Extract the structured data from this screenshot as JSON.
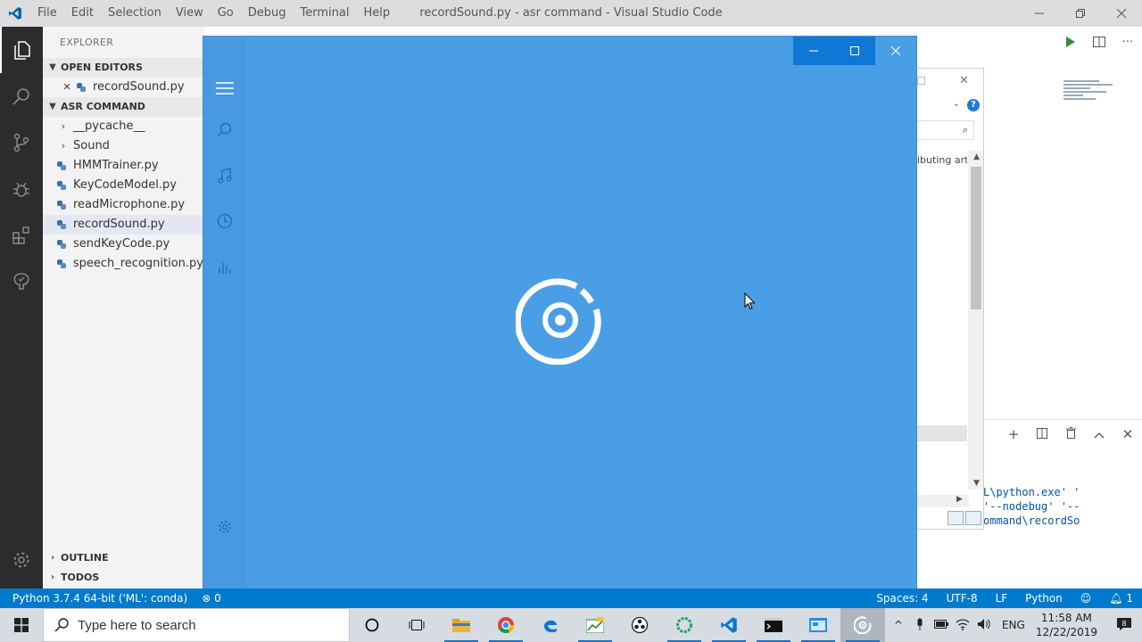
{
  "vscode": {
    "menu": [
      "File",
      "Edit",
      "Selection",
      "View",
      "Go",
      "Debug",
      "Terminal",
      "Help"
    ],
    "title": "recordSound.py - asr command - Visual Studio Code",
    "sidebar": {
      "title": "EXPLORER",
      "open_editors_label": "OPEN EDITORS",
      "open_editor_file": "recordSound.py",
      "project_label": "ASR COMMAND",
      "folders": [
        "__pycache__",
        "Sound"
      ],
      "files": [
        "HMMTrainer.py",
        "KeyCodeModel.py",
        "readMicrophone.py",
        "recordSound.py",
        "sendKeyCode.py",
        "speech_recognition.py"
      ],
      "outline_label": "OUTLINE",
      "todos_label": "TODOS"
    },
    "dialog_partial_text": "ibuting art",
    "terminal_lines": [
      "L\\python.exe' '",
      "'--nodebug' '--",
      "ommand\\recordSo"
    ],
    "statusbar": {
      "interpreter": "Python 3.7.4 64-bit ('ML': conda)",
      "problems": "0",
      "spaces": "Spaces: 4",
      "encoding": "UTF-8",
      "eol": "LF",
      "language": "Python",
      "notifications": "1"
    }
  },
  "taskbar": {
    "search_placeholder": "Type here to search",
    "lang": "ENG",
    "time": "11:58 AM",
    "date": "12/22/2019"
  },
  "colors": {
    "groove_blue": "#4a9ee6",
    "statusbar_blue": "#007acc",
    "activity_bar": "#2c2c2c"
  }
}
